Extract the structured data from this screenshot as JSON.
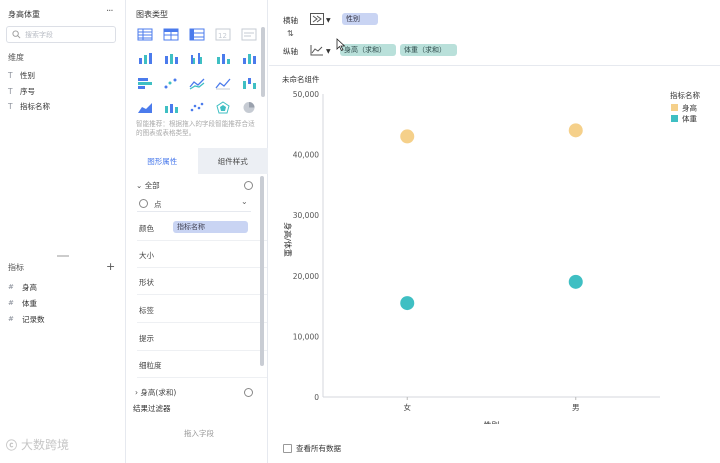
{
  "data_panel": {
    "title": "身高体重",
    "search_placeholder": "搜索字段",
    "dimensions_title": "维度",
    "dimensions": [
      {
        "type": "T",
        "name": "性别"
      },
      {
        "type": "T",
        "name": "序号"
      },
      {
        "type": "T",
        "name": "指标名称"
      }
    ],
    "measures_title": "指标",
    "measures": [
      {
        "type": "#",
        "name": "身高"
      },
      {
        "type": "#",
        "name": "体重"
      },
      {
        "type": "#",
        "name": "记录数"
      }
    ],
    "watermark": "大数跨境"
  },
  "prop_panel": {
    "chart_type_title": "图表类型",
    "hint": "智能推荐：根据拖入的字段智能推荐合适的图表或表格类型。",
    "tabs": [
      "图形属性",
      "组件样式"
    ],
    "all_label": "全部",
    "mark_type": "点",
    "rows": {
      "color": "颜色",
      "size": "大小",
      "shape": "形状",
      "label": "标签",
      "tooltip": "提示",
      "granularity": "细粒度"
    },
    "color_field": "指标名称",
    "sub_item": "身高(求和)",
    "filter_title": "结果过滤器",
    "filter_drop": "拖入字段"
  },
  "axis_bar": {
    "x_label": "横轴",
    "y_label": "纵轴",
    "x_field": "性别",
    "y_fields": [
      "身高（求和）",
      "体重（求和）"
    ]
  },
  "widget_title": "未命名组件",
  "view_all_label": "查看所有数据",
  "colors": {
    "height": "#f5d08a",
    "weight": "#3fbfc3",
    "accent": "#4b7bec"
  },
  "chart_data": {
    "type": "scatter",
    "categories": [
      "女",
      "男"
    ],
    "series": [
      {
        "name": "身高",
        "values": [
          43000,
          44000
        ]
      },
      {
        "name": "体重",
        "values": [
          15500,
          19000
        ]
      }
    ],
    "xlabel": "性别",
    "ylabel": "身高/体重",
    "legend_title": "指标名称",
    "ylim": [
      0,
      50000
    ],
    "yticks": [
      "0",
      "10,000",
      "20,000",
      "30,000",
      "40,000",
      "50,000"
    ],
    "yticks_values": [
      0,
      10000,
      20000,
      30000,
      40000,
      50000
    ],
    "legend_position": "top-right"
  }
}
